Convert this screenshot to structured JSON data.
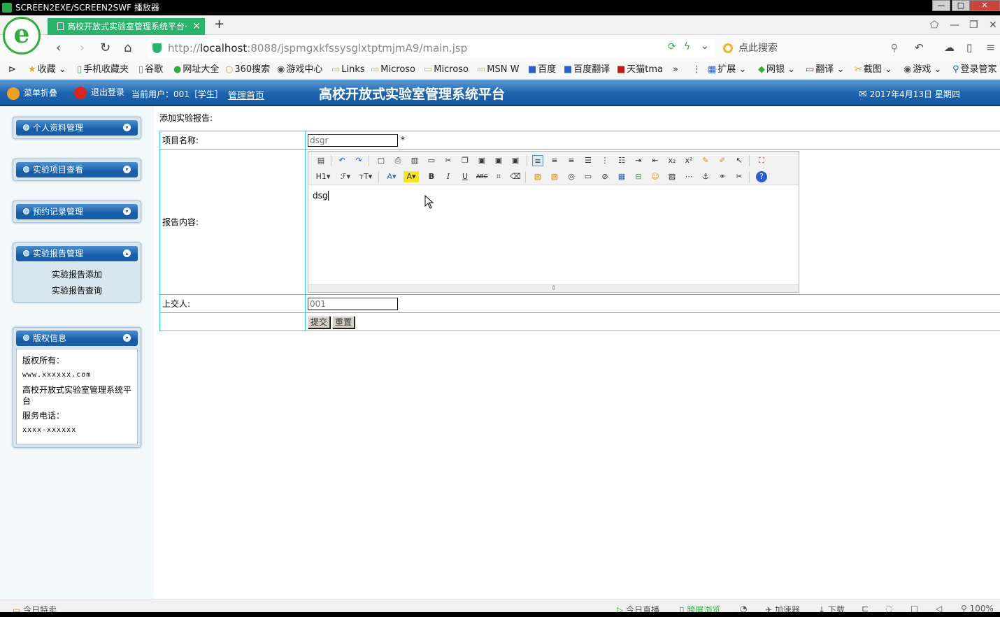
{
  "window": {
    "title": "SCREEN2EXE/SCREEN2SWF 播放器"
  },
  "browser": {
    "tab_title": "高校开放式实验室管理系统平台·",
    "url_prefix": "http://",
    "url_host": "localhost",
    "url_rest": ":8088/jspmgxkfssysglxtptmjmA9/main.jsp",
    "search_placeholder": "点此搜索",
    "bookmarks": [
      "收藏",
      "手机收藏夹",
      "谷歌",
      "网址大全",
      "360搜索",
      "游戏中心",
      "Links",
      "Microso",
      "Microso",
      "MSN W",
      "百度",
      "百度翻译",
      "天猫tma"
    ],
    "bookmarks_right": [
      "扩展",
      "网银",
      "翻译",
      "截图",
      "游戏",
      "登录管家"
    ]
  },
  "header": {
    "menu_fold": "菜单折叠",
    "logout": "退出登录",
    "current_user": "当前用户：001［学生］",
    "home_link": "管理首页",
    "system_title": "高校开放式实验室管理系统平台",
    "date": "2017年4月13日 星期四"
  },
  "sidebar": {
    "panels": [
      {
        "title": "个人资料管理"
      },
      {
        "title": "实验项目查看"
      },
      {
        "title": "预约记录管理"
      },
      {
        "title": "实验报告管理",
        "items": [
          "实验报告添加",
          "实验报告查询"
        ]
      },
      {
        "title": "版权信息"
      }
    ],
    "copyright": {
      "owner_label": "版权所有：",
      "site": "www.xxxxxx.com",
      "system": "高校开放式实验室管理系统平台",
      "phone_label": "服务电话：",
      "phone": "xxxx-xxxxxx"
    }
  },
  "form": {
    "page_title": "添加实验报告:",
    "project_label": "项目名称:",
    "project_value": "dsgr",
    "required_mark": "*",
    "content_label": "报告内容:",
    "content_value": "dsg",
    "submitter_label": "上交人:",
    "submitter_value": "001",
    "submit_label": "提交",
    "reset_label": "重置"
  },
  "statusbar": {
    "left": "今日特卖",
    "live": "今日直播",
    "cross": "跨屏浏览",
    "accel": "加速器",
    "download": "下载",
    "zoom": "100%"
  }
}
